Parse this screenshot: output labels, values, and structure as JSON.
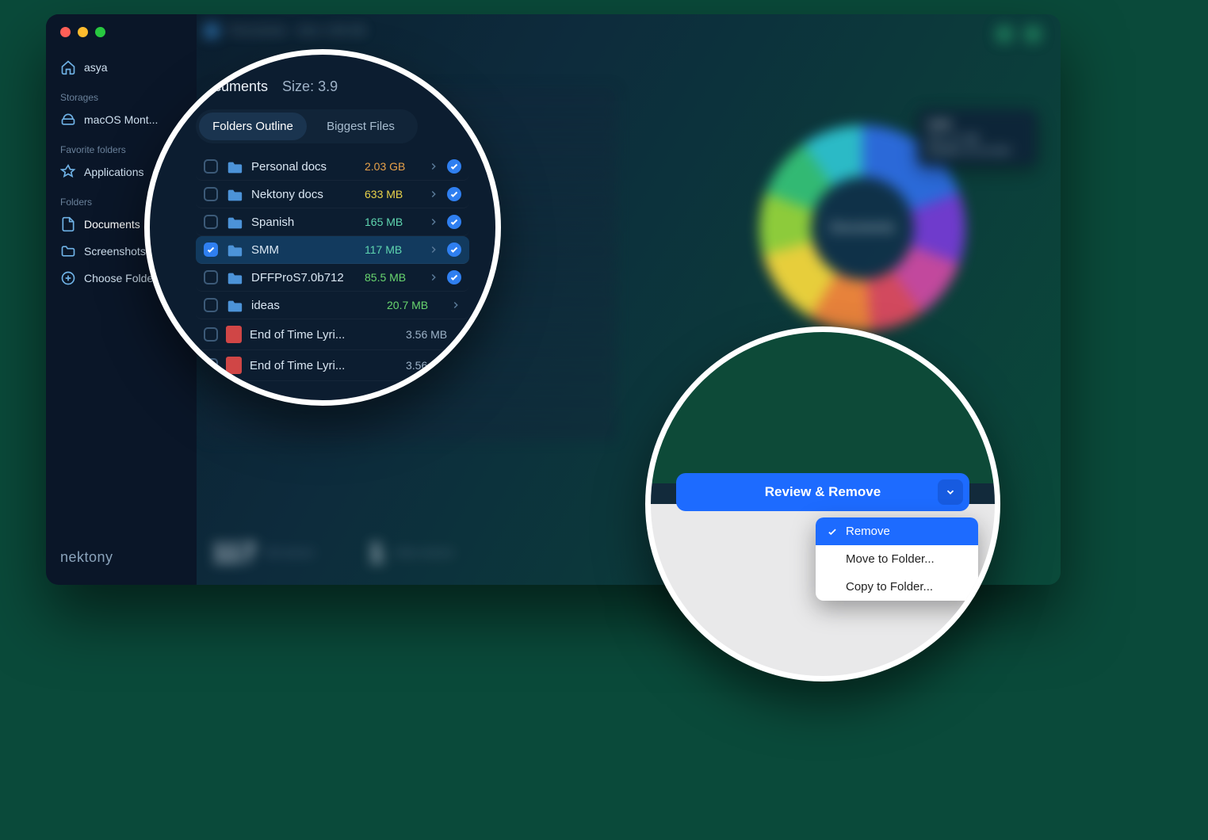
{
  "window": {
    "title_folder": "Documents",
    "title_size_label": "Size: 3.99 GB"
  },
  "sidebar": {
    "home": "asya",
    "storages_heading": "Storages",
    "storage_item": "macOS Mont...",
    "favorites_heading": "Favorite folders",
    "favorites_item": "Applications",
    "folders_heading": "Folders",
    "folders": [
      "Documents",
      "Screenshots"
    ],
    "choose_folder": "Choose Folder",
    "brand": "nektony"
  },
  "footer": {
    "count1": "117",
    "count1_label": "MB\nselected",
    "count2": "1",
    "count2_label": "Folder\nselected"
  },
  "donut": {
    "center_label": "Documents",
    "tooltip_title": "SMM",
    "tooltip_line1": "Size: 117 MB",
    "tooltip_line2": "Modified: 30 Jul 2023"
  },
  "c1": {
    "header_folder": "Documents",
    "header_size": "Size: 3.9",
    "tab1": "Folders Outline",
    "tab2": "Biggest Files",
    "rows": [
      {
        "name": "Personal docs",
        "size": "2.03 GB",
        "size_class": "c-orange",
        "checked": false,
        "kind": "folder",
        "chev": true,
        "radio": true
      },
      {
        "name": "Nektony docs",
        "size": "633 MB",
        "size_class": "c-yellow",
        "checked": false,
        "kind": "folder",
        "chev": true,
        "radio": true
      },
      {
        "name": "Spanish",
        "size": "165 MB",
        "size_class": "c-teal",
        "checked": false,
        "kind": "folder",
        "chev": true,
        "radio": true
      },
      {
        "name": "SMM",
        "size": "117 MB",
        "size_class": "c-teal",
        "checked": true,
        "kind": "folder",
        "chev": true,
        "radio": true,
        "selected": true
      },
      {
        "name": "DFFProS7.0b712",
        "size": "85.5 MB",
        "size_class": "c-green",
        "checked": false,
        "kind": "folder",
        "chev": true,
        "radio": true
      },
      {
        "name": "ideas",
        "size": "20.7 MB",
        "size_class": "c-green",
        "checked": false,
        "kind": "folder",
        "chev": true,
        "radio": false
      },
      {
        "name": "End of Time Lyri...",
        "size": "3.56 MB",
        "size_class": "c-grey",
        "checked": false,
        "kind": "pdf",
        "chev": false,
        "radio": false
      },
      {
        "name": "End of Time Lyri...",
        "size": "3.56",
        "size_class": "c-grey",
        "checked": false,
        "kind": "pdf",
        "chev": false,
        "radio": false
      }
    ]
  },
  "c2": {
    "button_label": "Review & Remove",
    "menu": [
      {
        "label": "Remove",
        "active": true
      },
      {
        "label": "Move to Folder...",
        "active": false
      },
      {
        "label": "Copy to Folder...",
        "active": false
      }
    ]
  }
}
